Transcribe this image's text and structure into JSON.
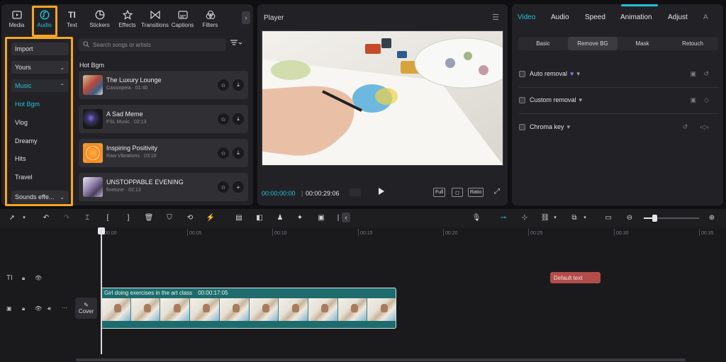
{
  "left_panel": {
    "tabs": [
      {
        "label": "Media",
        "icon": "media-icon"
      },
      {
        "label": "Audio",
        "icon": "audio-icon",
        "active": true
      },
      {
        "label": "Text",
        "icon": "text-icon"
      },
      {
        "label": "Stickers",
        "icon": "stickers-icon"
      },
      {
        "label": "Effects",
        "icon": "effects-icon"
      },
      {
        "label": "Transitions",
        "icon": "transitions-icon"
      },
      {
        "label": "Captions",
        "icon": "captions-icon"
      },
      {
        "label": "Filters",
        "icon": "filters-icon"
      }
    ],
    "categories": {
      "import": "Import",
      "yours": "Yours",
      "music": "Music",
      "sub_items": [
        "Hot Bgm",
        "Vlog",
        "Dreamy",
        "Hits",
        "Travel"
      ],
      "sounds": "Sounds effe..."
    },
    "search_placeholder": "Search songs or artists",
    "section_title": "Hot Bgm",
    "tracks": [
      {
        "title": "The Luxury Lounge",
        "artist": "Cassiopeia",
        "duration": "01:40",
        "action": "download"
      },
      {
        "title": "A Sad Meme",
        "artist": "FSL Music",
        "duration": "02:13",
        "action": "download"
      },
      {
        "title": "Inspiring Positivity",
        "artist": "Raw Vibrations",
        "duration": "03:10",
        "action": "download"
      },
      {
        "title": "UNSTOPPABLE EVENING",
        "artist": "finetune",
        "duration": "02:13",
        "action": "add"
      }
    ],
    "track_meta": [
      "Cassiopeia · 01:40",
      "FSL Music · 02:13",
      "Raw Vibrations · 03:10",
      "finetune · 02:13"
    ]
  },
  "player": {
    "title": "Player",
    "current_time": "00:00:00:00",
    "total_time": "00:00:29:06",
    "separator": "|",
    "full_label": "Full",
    "ratio_label": "Ratio"
  },
  "right_panel": {
    "tabs": [
      "Video",
      "Audio",
      "Speed",
      "Animation",
      "Adjust",
      "A"
    ],
    "subtabs": [
      "Basic",
      "Remove BG",
      "Mask",
      "Retouch"
    ],
    "options": [
      "Auto removal",
      "Custom removal",
      "Chroma key"
    ]
  },
  "timeline": {
    "ruler": [
      "00:00",
      "00:05",
      "00:10",
      "00:15",
      "00:20",
      "00:25",
      "00:30",
      "00:35"
    ],
    "text_clip": "Default text",
    "cover_label": "Cover",
    "clip_label": "Girl doing exercises in the art class",
    "clip_duration": "00:00:17:05"
  },
  "colors": {
    "accent": "#22c1d8",
    "highlight": "#f5a623",
    "text_clip": "#b24c4a",
    "video_clip": "#1e6b6d"
  }
}
